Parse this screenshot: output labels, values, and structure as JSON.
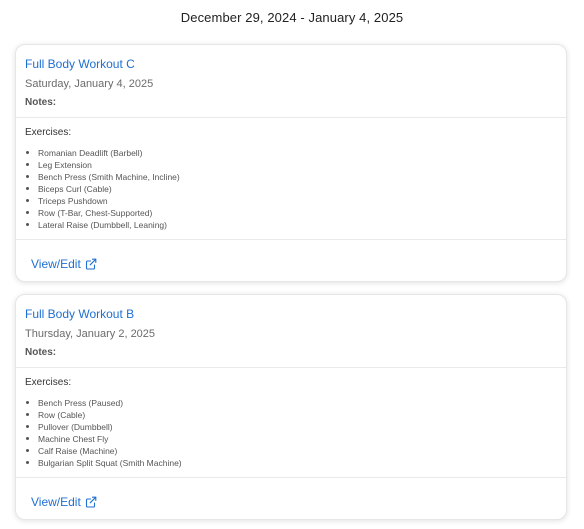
{
  "header": {
    "week_range": "December 29, 2024 - January 4, 2025"
  },
  "workouts": [
    {
      "title": "Full Body Workout C",
      "date": "Saturday, January 4, 2025",
      "notes_label": "Notes:",
      "exercises_label": "Exercises:",
      "exercises": [
        "Romanian Deadlift (Barbell)",
        "Leg Extension",
        "Bench Press (Smith Machine, Incline)",
        "Biceps Curl (Cable)",
        "Triceps Pushdown",
        "Row (T-Bar, Chest-Supported)",
        "Lateral Raise (Dumbbell, Leaning)"
      ],
      "action_label": "View/Edit",
      "action_icon": "external-link-icon"
    },
    {
      "title": "Full Body Workout B",
      "date": "Thursday, January 2, 2025",
      "notes_label": "Notes:",
      "exercises_label": "Exercises:",
      "exercises": [
        "Bench Press (Paused)",
        "Row (Cable)",
        "Pullover (Dumbbell)",
        "Machine Chest Fly",
        "Calf Raise (Machine)",
        "Bulgarian Split Squat (Smith Machine)"
      ],
      "action_label": "View/Edit",
      "action_icon": "external-link-icon"
    }
  ],
  "colors": {
    "link": "#1f6fd1",
    "muted_text": "#6b6b6b",
    "border": "#e9e9e9"
  }
}
